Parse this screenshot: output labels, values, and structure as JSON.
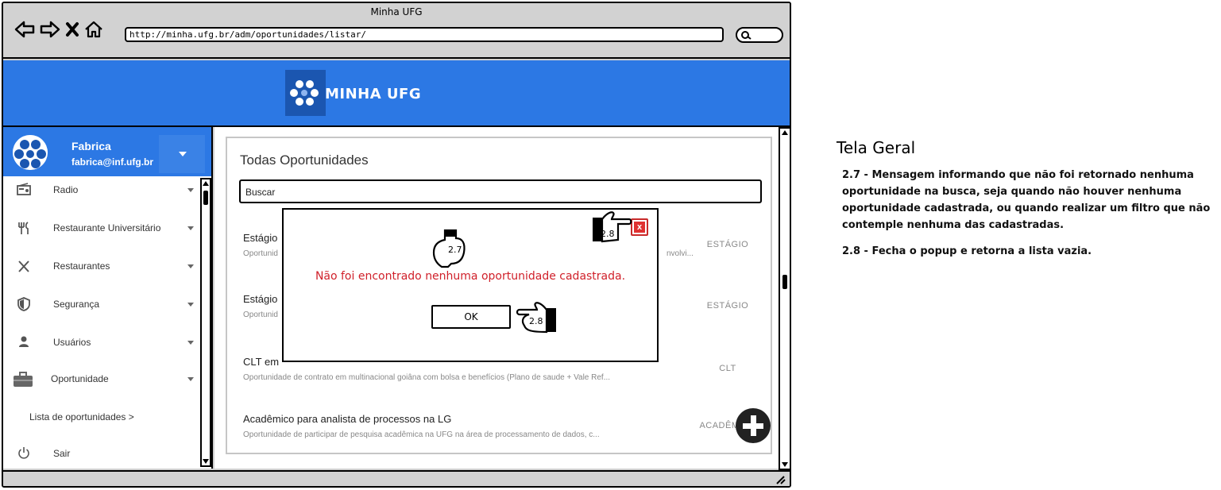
{
  "window": {
    "title": "Minha UFG",
    "url": "http://minha.ufg.br/adm/oportunidades/listar/"
  },
  "header": {
    "brand": "MINHA UFG",
    "brand_color": "#2c78e4"
  },
  "user": {
    "name": "Fabrica",
    "email": "fabrica@inf.ufg.br"
  },
  "sidebar": {
    "items": [
      {
        "label": "Radio",
        "icon": "radio-icon"
      },
      {
        "label": "Restaurante Universitário",
        "icon": "fork-knife-icon"
      },
      {
        "label": "Restaurantes",
        "icon": "utensils-icon"
      },
      {
        "label": "Segurança",
        "icon": "shield-icon"
      },
      {
        "label": "Usuários",
        "icon": "user-icon"
      },
      {
        "label": "Oportunidade",
        "icon": "briefcase-icon"
      }
    ],
    "submenu": "Lista de oportunidades  >",
    "logout": "Sair"
  },
  "main": {
    "title": "Todas Oportunidades",
    "search_placeholder": "Buscar",
    "rows": [
      {
        "title": "Estágio",
        "desc": "Oportunid",
        "desc_tail": "nvolvi...",
        "tag": "ESTÁGIO"
      },
      {
        "title": "Estágio",
        "desc": "Oportunid",
        "desc_tail": "",
        "tag": "ESTÁGIO"
      },
      {
        "title": "CLT em",
        "desc": "Oportunidade de contrato em multinacional goiâna com bolsa e benefícios (Plano de saude + Vale Ref...",
        "desc_tail": "",
        "tag": "CLT"
      },
      {
        "title": "Acadêmico para analista de processos na LG",
        "desc": "Oportunidade de participar de pesquisa acadêmica na UFG na área de processamento de dados, c...",
        "desc_tail": "",
        "tag": "ACADÊMICO"
      }
    ]
  },
  "popup": {
    "message": "Não foi encontrado nenhuma oportunidade cadastrada.",
    "ok_label": "OK",
    "close_label": "x",
    "message_color": "#d0202a"
  },
  "annotations": {
    "a27": "2.7",
    "a28_close": "2.8",
    "a28_ok": "2.8"
  },
  "notes": {
    "title": "Tela Geral",
    "n27": "2.7 - Mensagem informando que não foi retornado nenhuma oportunidade na busca, seja quando não houver nenhuma oportunidade cadastrada, ou quando realizar um filtro que não contemple nenhuma das cadastradas.",
    "n28": "2.8 - Fecha o popup e retorna a lista vazia."
  }
}
